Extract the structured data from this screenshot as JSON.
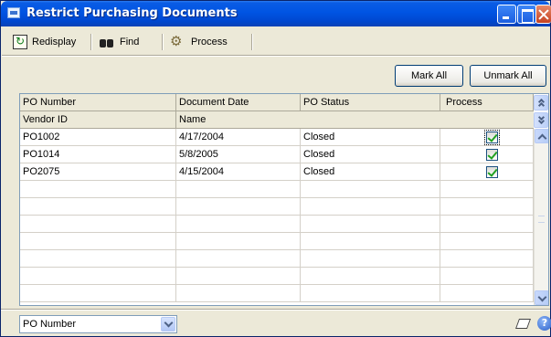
{
  "window": {
    "title": "Restrict Purchasing Documents"
  },
  "toolbar": {
    "redisplay_label": "Redisplay",
    "find_label": "Find",
    "process_label": "Process"
  },
  "buttons": {
    "mark_all": "Mark All",
    "unmark_all": "Unmark All"
  },
  "grid": {
    "header_row1": [
      "PO Number",
      "Document Date",
      "PO Status",
      "Process"
    ],
    "header_row2": [
      "Vendor ID",
      "Name"
    ],
    "rows": [
      {
        "po_number": "PO1002",
        "document_date": "4/17/2004",
        "po_status": "Closed",
        "process": true
      },
      {
        "po_number": "PO1014",
        "document_date": "5/8/2005",
        "po_status": "Closed",
        "process": true
      },
      {
        "po_number": "PO2075",
        "document_date": "4/15/2004",
        "po_status": "Closed",
        "process": true
      }
    ],
    "empty_rows": 7
  },
  "footer": {
    "sort_by": "PO Number"
  },
  "icons": {
    "title": "window-icon",
    "redisplay": "redisplay-icon",
    "find": "binoculars-icon",
    "process": "gears-icon",
    "note": "note-icon",
    "help": "help-icon"
  },
  "colors": {
    "titlebar": "#0054e3",
    "checkmark": "#21a121",
    "grid_border": "#7f9db9"
  }
}
